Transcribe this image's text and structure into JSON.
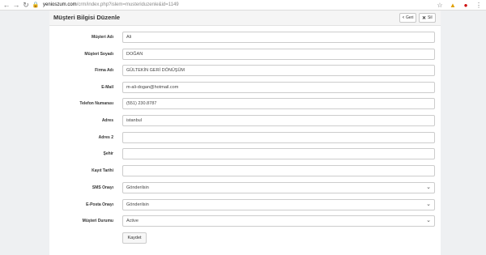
{
  "browser": {
    "url_domain": "yenioszum.com",
    "url_path": "/crm/index.php?islem=musteriduzenle&id=1149"
  },
  "header": {
    "title": "Müşteri Bilgisi Düzenle",
    "back_label": "Geri",
    "delete_label": "Sil"
  },
  "form": {
    "fields": [
      {
        "label": "Müşteri Adı",
        "value": "Ali"
      },
      {
        "label": "Müşteri Soyadı",
        "value": "DOĞAN"
      },
      {
        "label": "Firma Adı",
        "value": "GÜLTEKİN GERİ DÖNÜŞÜM"
      },
      {
        "label": "E-Mail",
        "value": "m-ali-dogan@hotmail.com"
      },
      {
        "label": "Telefon Numarası",
        "value": "(551) 230.8787"
      },
      {
        "label": "Adres",
        "value": "istanbul"
      },
      {
        "label": "Adres 2",
        "value": ""
      },
      {
        "label": "Şehir",
        "value": ""
      },
      {
        "label": "Kayıt Tarihi",
        "value": ""
      }
    ],
    "selects": [
      {
        "label": "SMS Onayı",
        "value": "Gönderilsin"
      },
      {
        "label": "E-Posta Onayı",
        "value": "Gönderilsin"
      },
      {
        "label": "Müşteri Durumu",
        "value": "Active"
      }
    ],
    "save_label": "Kaydet"
  }
}
